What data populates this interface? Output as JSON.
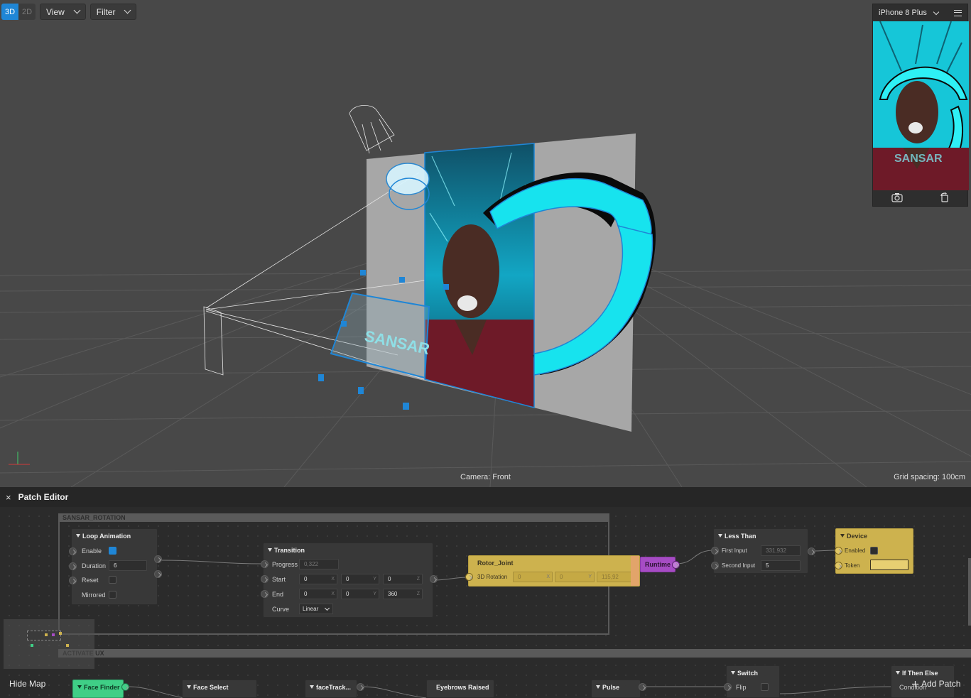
{
  "toolbar": {
    "mode_3d": "3D",
    "mode_2d": "2D",
    "view_label": "View",
    "filter_label": "Filter"
  },
  "viewport": {
    "camera_label": "Camera: Front",
    "grid_label": "Grid spacing: 100cm",
    "logo_text": "SANSAR"
  },
  "simulator": {
    "device": "iPhone 8 Plus",
    "logo_text": "SANSAR"
  },
  "patch_editor": {
    "title": "Patch Editor",
    "close_glyph": "×",
    "group_rotation": "SANSAR_ROTATION",
    "group_activate": "ACTIVATE UX",
    "hide_map": "Hide Map",
    "add_patch": "Add Patch",
    "loop_animation": {
      "title": "Loop Animation",
      "enable": "Enable",
      "duration": "Duration",
      "duration_value": "6",
      "reset": "Reset",
      "mirrored": "Mirrored"
    },
    "transition": {
      "title": "Transition",
      "progress": "Progress",
      "progress_value": "0,322",
      "start": "Start",
      "start_values": [
        "0",
        "0",
        "0"
      ],
      "end": "End",
      "end_values": [
        "0",
        "0",
        "360"
      ],
      "curve": "Curve",
      "curve_value": "Linear",
      "axes": [
        "X",
        "Y",
        "Z"
      ]
    },
    "rotor_joint": {
      "title": "Rotor_Joint",
      "rotation": "3D Rotation",
      "values": [
        "0",
        "0",
        "115,92"
      ],
      "axes": [
        "X",
        "Y",
        "Z"
      ]
    },
    "runtime": {
      "title": "Runtime"
    },
    "less_than": {
      "title": "Less Than",
      "first_input": "First Input",
      "first_value": "331,932",
      "second_input": "Second Input",
      "second_value": "5"
    },
    "device": {
      "title": "Device",
      "enabled": "Enabled",
      "token": "Token"
    },
    "bottom_nodes": {
      "face_finder": "Face Finder",
      "face_select": "Face Select",
      "face_track": "faceTrack...",
      "eyebrows": "Eyebrows Raised",
      "pulse": "Pulse",
      "switch": "Switch",
      "flip": "Flip",
      "if_then_else": "If Then Else",
      "condition": "Condition"
    }
  },
  "colors": {
    "accent_blue": "#1f86d6",
    "cyan": "#16e4ee",
    "node_yellow": "#cdb24e",
    "runtime_purple": "#a64cc4",
    "face_finder_green": "#3fcf86"
  }
}
